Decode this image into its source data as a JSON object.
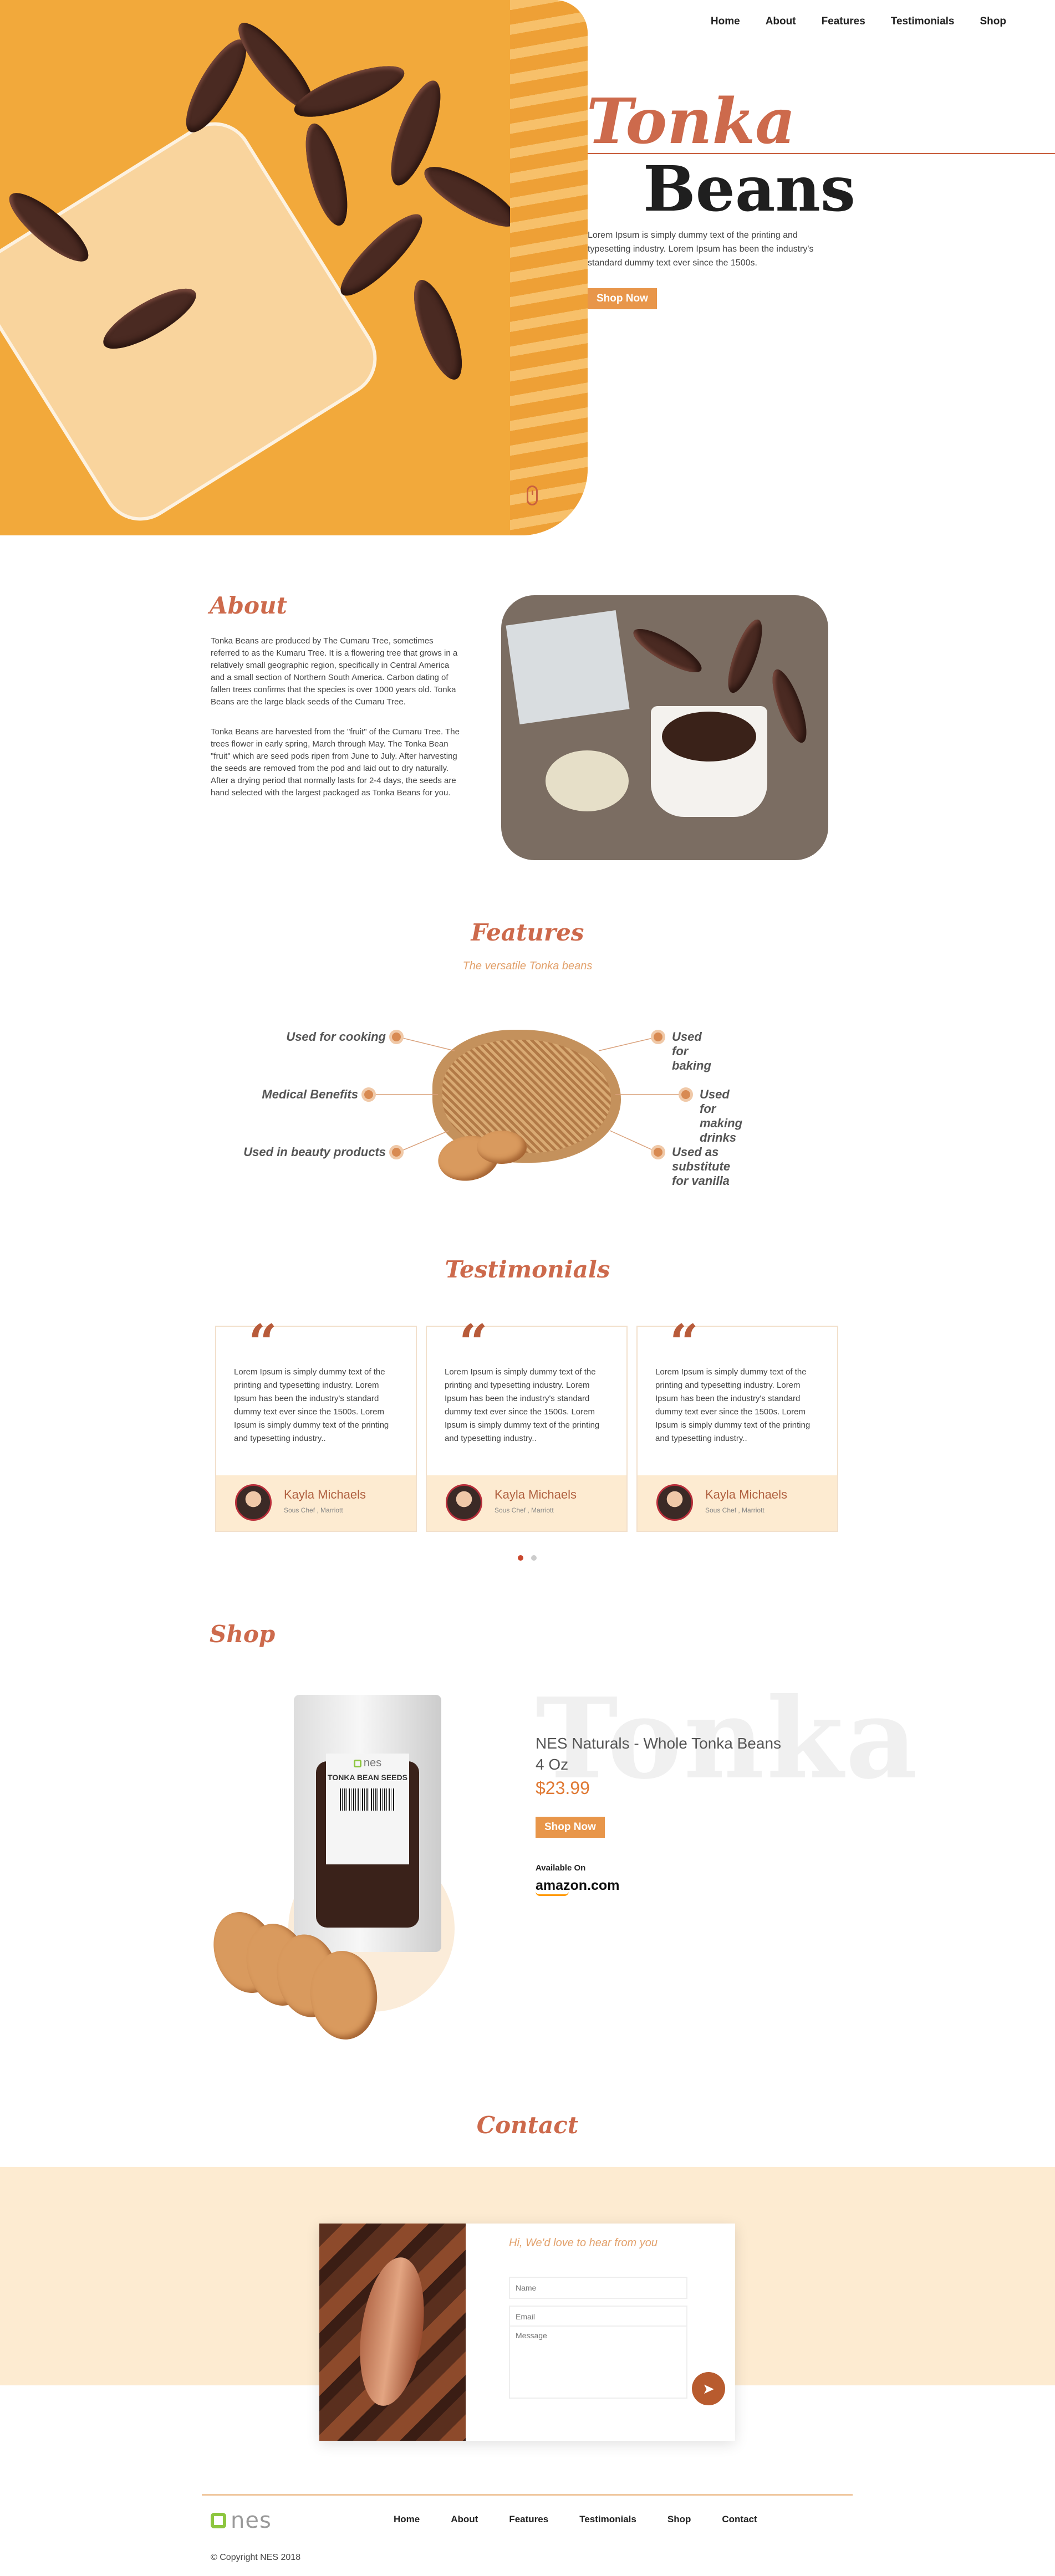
{
  "brand": {
    "name": "nes",
    "accent": "#cd6a4c",
    "orange": "#e8964a",
    "green": "#8dc63f"
  },
  "nav": {
    "items": [
      "Home",
      "About",
      "Features",
      "Testimonials",
      "Shop"
    ]
  },
  "hero": {
    "title_1": "Tonka",
    "title_2": "Beans",
    "text": "Lorem Ipsum is simply dummy text of the printing and typesetting industry. Lorem Ipsum has been the industry's standard dummy text ever since the 1500s.",
    "button": "Shop Now"
  },
  "about": {
    "title": "About",
    "p1": "Tonka Beans are produced by The Cumaru Tree, sometimes referred to as the Kumaru Tree. It is a flowering tree that grows in a relatively small geographic region, specifically in Central America and a small section of Northern South America. Carbon dating of fallen trees confirms that the species is over 1000 years old. Tonka Beans are the large black seeds of the Cumaru Tree.",
    "p2": "Tonka Beans are harvested from the \"fruit\" of the Cumaru Tree. The trees flower in early spring, March through May. The Tonka Bean \"fruit\" which are seed pods ripen from June to July. After harvesting the seeds are removed from the pod and laid out to dry naturally. After a drying period that normally lasts for 2-4 days, the seeds are hand selected with the largest packaged as Tonka Beans for you."
  },
  "features": {
    "title": "Features",
    "subtitle": "The versatile Tonka beans",
    "left": [
      "Used for cooking",
      "Medical Benefits",
      "Used in beauty products"
    ],
    "right": [
      "Used for baking",
      "Used for making drinks",
      "Used as substitute for vanilla"
    ]
  },
  "testimonials": {
    "title": "Testimonials",
    "cards": [
      {
        "text": "Lorem Ipsum is simply dummy text of the printing and typesetting industry. Lorem Ipsum has been the industry's standard dummy text ever since the 1500s. Lorem Ipsum is simply dummy text of the printing and typesetting industry..",
        "name": "Kayla Michaels",
        "role": "Sous Chef , Marriott"
      },
      {
        "text": "Lorem Ipsum is simply dummy text of the printing and typesetting industry. Lorem Ipsum has been the industry's standard dummy text ever since the 1500s. Lorem Ipsum is simply dummy text of the printing and typesetting industry..",
        "name": "Kayla Michaels",
        "role": "Sous Chef , Marriott"
      },
      {
        "text": "Lorem Ipsum is simply dummy text of the printing and typesetting industry. Lorem Ipsum has been the industry's standard dummy text ever since the 1500s. Lorem Ipsum is simply dummy text of the printing and typesetting industry..",
        "name": "Kayla Michaels",
        "role": "Sous Chef , Marriott"
      }
    ]
  },
  "shop": {
    "title": "Shop",
    "bg_word": "Tonka",
    "product": "NES Naturals - Whole Tonka Beans",
    "size": "4 Oz",
    "price": "$23.99",
    "button": "Shop Now",
    "available": "Available On",
    "store": "amazon.com",
    "bag_brand": "nes",
    "bag_label": "TONKA BEAN SEEDS"
  },
  "contact": {
    "title": "Contact",
    "heading": "Hi, We'd love to hear from you",
    "name_placeholder": "Name",
    "email_placeholder": "Email",
    "message_placeholder": "Message"
  },
  "footer": {
    "links": [
      "Home",
      "About",
      "Features",
      "Testimonials",
      "Shop",
      "Contact"
    ],
    "copyright": "© Copyright NES 2018"
  }
}
